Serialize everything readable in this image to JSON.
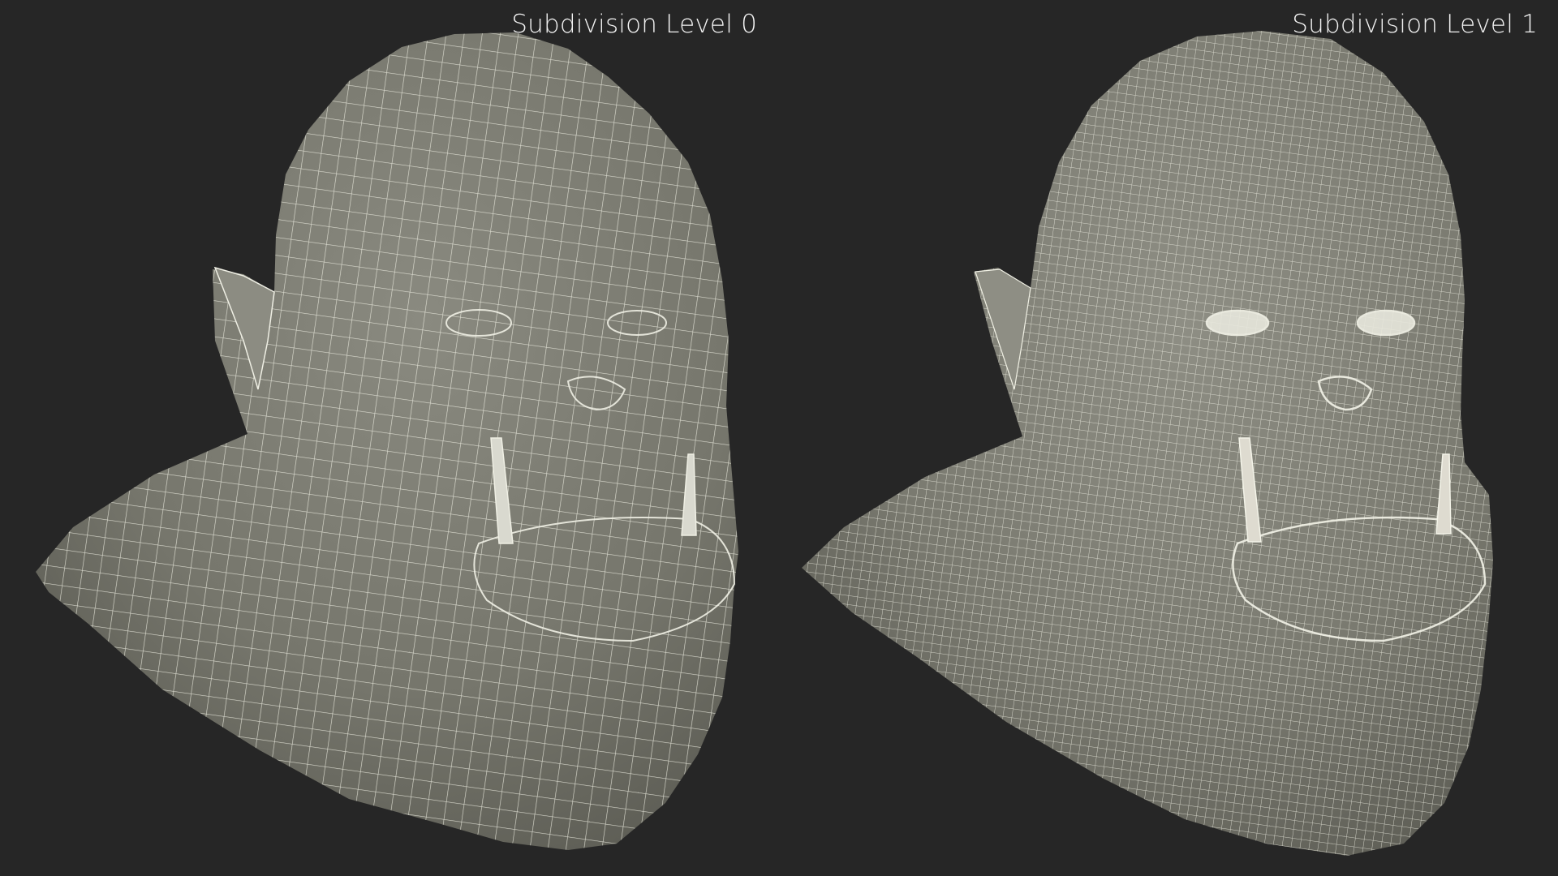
{
  "panels": [
    {
      "label": "Subdivision Level 0",
      "wire_density": "low"
    },
    {
      "label": "Subdivision Level 1",
      "wire_density": "high"
    }
  ],
  "colors": {
    "background": "#262626",
    "surface": "#7b7b72",
    "wire": "#efefe4",
    "label": "#f2f2f2"
  }
}
